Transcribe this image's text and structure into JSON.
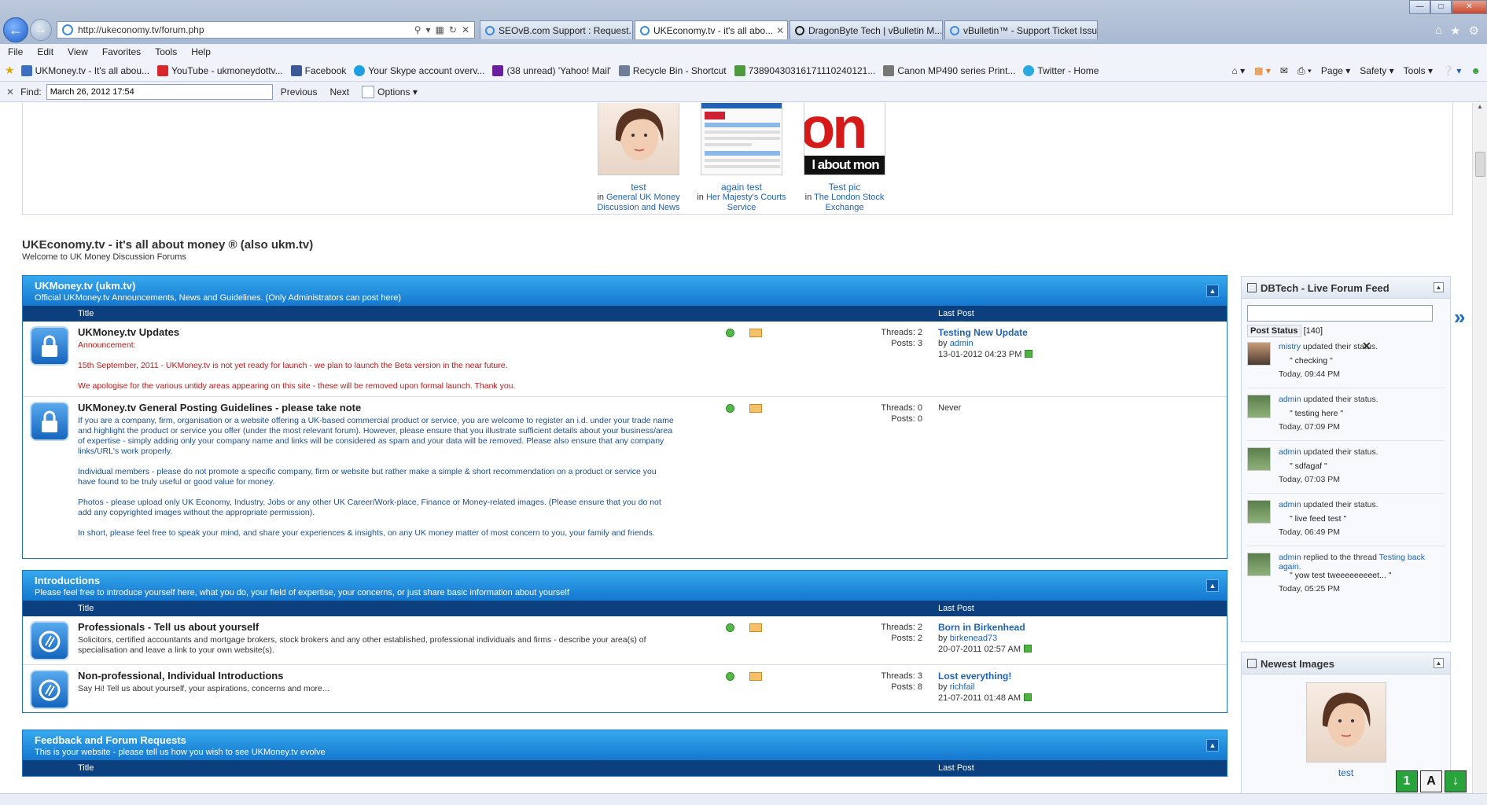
{
  "browser": {
    "url": "http://ukeconomy.tv/forum.php",
    "tabs": [
      {
        "label": "SEOvB.com Support : Request...",
        "active": false
      },
      {
        "label": "UKEconomy.tv - it's all abo...",
        "active": true
      },
      {
        "label": "DragonByte Tech | vBulletin M...",
        "active": false
      },
      {
        "label": "vBulletin™ - Support Ticket Issue",
        "active": false
      }
    ],
    "menu": [
      "File",
      "Edit",
      "View",
      "Favorites",
      "Tools",
      "Help"
    ],
    "favorites": [
      {
        "label": "UKMoney.tv - It's all abou...",
        "color": "#3b6fc4"
      },
      {
        "label": "YouTube - ukmoneydottv...",
        "color": "#d8262b"
      },
      {
        "label": "Facebook",
        "color": "#3b5998"
      },
      {
        "label": "Your Skype account overv...",
        "color": "#1ea0e0"
      },
      {
        "label": "(38 unread) 'Yahoo! Mail'",
        "color": "#6b1fa0"
      },
      {
        "label": "Recycle Bin - Shortcut",
        "color": "#6f7f99"
      },
      {
        "label": "73890430316171110240121...",
        "color": "#4e9a3f"
      },
      {
        "label": "Canon MP490 series Print...",
        "color": "#777777"
      },
      {
        "label": "Twitter - Home",
        "color": "#2aa9e0"
      }
    ],
    "command_bar": [
      "Page",
      "Safety",
      "Tools"
    ],
    "find": {
      "label": "Find:",
      "value": "March 26, 2012 17:54",
      "previous": "Previous",
      "next": "Next",
      "options": "Options"
    }
  },
  "gallery": [
    {
      "title": "test",
      "in_label": "in",
      "forum": "General UK Money Discussion and News"
    },
    {
      "title": "again test",
      "in_label": "in",
      "forum": "Her Majesty's Courts Service"
    },
    {
      "title": "Test pic",
      "in_label": "in",
      "forum": "The London Stock Exchange"
    }
  ],
  "gallery_pic_text": "l about mon",
  "site": {
    "title": "UKEconomy.tv - it's all about money ® (also ukm.tv)",
    "subtitle": "Welcome to UK Money Discussion Forums"
  },
  "columns": {
    "title": "Title",
    "last_post": "Last Post"
  },
  "categories": [
    {
      "name": "UKMoney.tv (ukm.tv)",
      "description": "Official UKMoney.tv Announcements, News and Guidelines. (Only Administrators can post here)",
      "forums": [
        {
          "name": "UKMoney.tv Updates",
          "announcement": "Announcement:",
          "desc1": "15th September, 2011 - UKMoney.tv is not yet ready for launch - we plan to launch the Beta version in the near future.",
          "desc2": "We apologise for the various untidy areas appearing on this site - these will be removed upon formal launch. Thank you.",
          "threads": "Threads: 2",
          "posts": "Posts: 3",
          "last_title": "Testing New Update",
          "last_by": "by",
          "last_user": "admin",
          "last_date": "13-01-2012 04:23 PM"
        },
        {
          "name": "UKMoney.tv General Posting Guidelines - please take note",
          "p1": "If you are a company, firm, organisation or a website offering a UK-based commercial product or service, you are welcome to register an i.d. under your trade name and highlight the product or service you offer (under the most relevant forum). However, please ensure that you illustrate sufficient details about your business/area of expertise - simply adding only your company name and links will be considered as spam and your data will be removed. Please also ensure that any company links/URL's work properly.",
          "p2": "Individual members - please do not promote a specific company, firm or website but rather make a simple & short recommendation on a product or service you have found to be truly useful or good value for money.",
          "p3": "Photos - please upload only UK Economy, Industry, Jobs or any other UK Career/Work-place, Finance or Money-related images. (Please ensure that you do not add any copyrighted images without the appropriate permission).",
          "p4": "In short, please feel free to speak your mind, and share your experiences & insights, on any UK money matter of most concern to you, your family and friends.",
          "threads": "Threads: 0",
          "posts": "Posts: 0",
          "last_never": "Never"
        }
      ]
    },
    {
      "name": "Introductions",
      "description": "Please feel free to introduce yourself here, what you do, your field of expertise, your concerns, or just share basic information about yourself",
      "forums": [
        {
          "name": "Professionals - Tell us about yourself",
          "desc": "Solicitors, certified accountants and mortgage brokers, stock brokers and any other established, professional individuals and firms - describe your area(s) of specialisation and leave a link to your own website(s).",
          "threads": "Threads: 2",
          "posts": "Posts: 2",
          "last_title": "Born in Birkenhead",
          "last_by": "by",
          "last_user": "birkenead73",
          "last_date": "20-07-2011 02:57 AM"
        },
        {
          "name": "Non-professional, Individual Introductions",
          "desc": "Say Hi! Tell us about yourself, your aspirations, concerns and more...",
          "threads": "Threads: 3",
          "posts": "Posts: 8",
          "last_title": "Lost everything!",
          "last_by": "by",
          "last_user": "richfail",
          "last_date": "21-07-2011 01:48 AM"
        }
      ]
    },
    {
      "name": "Feedback and Forum Requests",
      "description": "This is your website - please tell us how you wish to see UKMoney.tv evolve"
    }
  ],
  "sidebar": {
    "feed_title": "DBTech - Live Forum Feed",
    "post_status_label": "Post Status",
    "post_status_count": "[140]",
    "feed": [
      {
        "user": "mistry",
        "action": "updated their status.",
        "quote": "\" checking \"",
        "time": "Today, 09:44 PM"
      },
      {
        "user": "admin",
        "action": "updated their status.",
        "quote": "\" testing here \"",
        "time": "Today, 07:09 PM"
      },
      {
        "user": "admin",
        "action": "updated their status.",
        "quote": "\" sdfagaf \"",
        "time": "Today, 07:03 PM"
      },
      {
        "user": "admin",
        "action": "updated their status.",
        "quote": "\" live feed test \"",
        "time": "Today, 06:49 PM"
      },
      {
        "user": "admin",
        "action": "replied to the thread",
        "thread": "Testing back again.",
        "quote": "\" yow test tweeeeeeeeet... \"",
        "time": "Today, 05:25 PM"
      }
    ],
    "images_title": "Newest Images",
    "image_caption": "test"
  },
  "tray": [
    "1",
    "A",
    "↓"
  ]
}
